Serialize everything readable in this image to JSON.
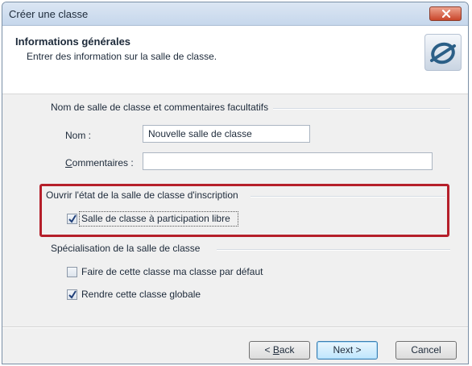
{
  "window": {
    "title": "Créer une classe"
  },
  "header": {
    "title": "Informations générales",
    "subtitle": "Entrer des information sur la salle de classe."
  },
  "group_names": {
    "label": "Nom de salle de classe et commentaires facultatifs",
    "name_label": "Nom :",
    "name_value": "Nouvelle salle de classe",
    "comments_label_first": "C",
    "comments_label_rest": "ommentaires :",
    "comments_value": ""
  },
  "group_state": {
    "label": "Ouvrir l'état de la salle de classe d'inscription",
    "checkbox_label": "Salle de classe à participation libre",
    "checkbox_checked": true
  },
  "group_spec": {
    "label": "Spécialisation de la salle de classe",
    "default_label": "Faire de cette classe ma classe par défaut",
    "default_checked": false,
    "global_label": "Rendre cette classe globale",
    "global_checked": true
  },
  "buttons": {
    "back_prefix": "< ",
    "back_first": "B",
    "back_rest": "ack",
    "next": "Next >",
    "cancel": "Cancel"
  },
  "colors": {
    "highlight": "#b51f2a",
    "accent": "#3c7fb1"
  }
}
